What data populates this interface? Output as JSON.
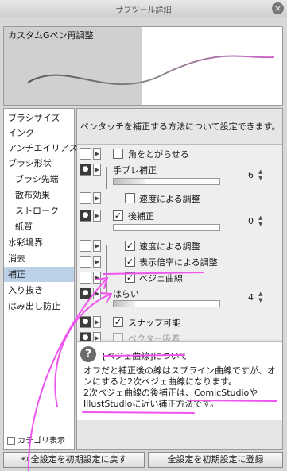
{
  "window": {
    "title": "サブツール詳細",
    "close_icon": "close-icon"
  },
  "preview": {
    "label": "カスタムGペン再調整"
  },
  "sidebar": {
    "items": [
      {
        "label": "ブラシサイズ",
        "sub": false,
        "selected": false
      },
      {
        "label": "インク",
        "sub": false,
        "selected": false
      },
      {
        "label": "アンチエイリアス",
        "sub": false,
        "selected": false
      },
      {
        "label": "ブラシ形状",
        "sub": false,
        "selected": false
      },
      {
        "label": "ブラシ先端",
        "sub": true,
        "selected": false
      },
      {
        "label": "散布効果",
        "sub": true,
        "selected": false
      },
      {
        "label": "ストローク",
        "sub": true,
        "selected": false
      },
      {
        "label": "紙質",
        "sub": true,
        "selected": false
      },
      {
        "label": "水彩境界",
        "sub": false,
        "selected": false
      },
      {
        "label": "消去",
        "sub": false,
        "selected": false
      },
      {
        "label": "補正",
        "sub": false,
        "selected": true
      },
      {
        "label": "入り抜き",
        "sub": false,
        "selected": false
      },
      {
        "label": "はみ出し防止",
        "sub": false,
        "selected": false
      }
    ],
    "category_toggle": "カテゴリ表示"
  },
  "content": {
    "description": "ペンタッチを補正する方法について設定できます。",
    "rows": {
      "sharpen_corners": {
        "label": "角をとがらせる",
        "checked": false
      },
      "stabilization": {
        "label": "手ブレ補正",
        "value": "6",
        "fill": 0.3
      },
      "speed_stab": {
        "label": "速度による調整",
        "checked": false
      },
      "post_correction": {
        "label": "後補正",
        "checked": true,
        "value": "0",
        "fill": 0.0
      },
      "speed_post": {
        "label": "速度による調整",
        "checked": true
      },
      "zoom_post": {
        "label": "表示倍率による調整",
        "checked": true
      },
      "bezier": {
        "label": "ベジェ曲線",
        "checked": true
      },
      "harai": {
        "label": "はらい",
        "value": "4",
        "fill": 0.2
      },
      "snap": {
        "label": "スナップ可能",
        "checked": true
      },
      "vector_snap": {
        "label": "ベクター吸着",
        "checked": false
      }
    },
    "help": {
      "title": "[ベジェ曲線]について",
      "line1": "オフだと補正後の線はスプライン曲線ですが、オンにすると2次ベジェ曲線になります。",
      "line2": "2次ベジェ曲線の後補正は、ComicStudioやIllustStudioに近い補正方法です。"
    }
  },
  "buttons": {
    "reset_all": "全設定を初期設定に戻す",
    "register_all": "全設定を初期設定に登録"
  },
  "colors": {
    "annotation": "#ee55ee",
    "selection": "#bcd0e8"
  }
}
